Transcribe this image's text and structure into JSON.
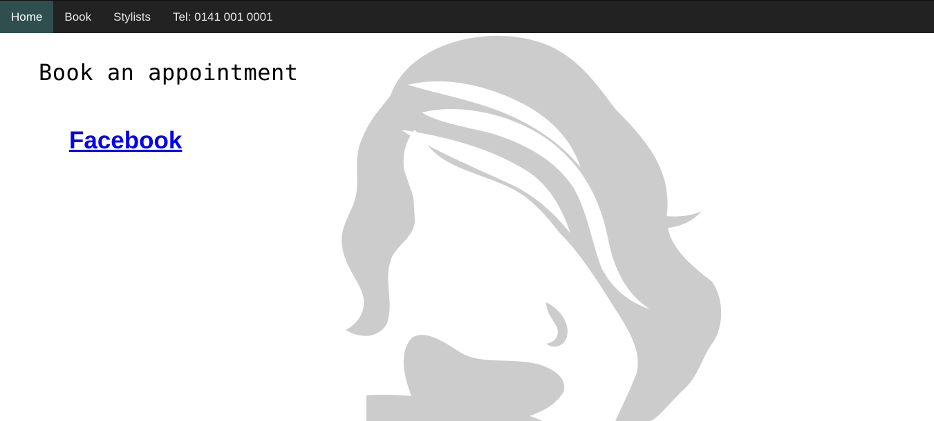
{
  "nav": {
    "items": [
      {
        "label": "Home",
        "active": true
      },
      {
        "label": "Book",
        "active": false
      },
      {
        "label": "Stylists",
        "active": false
      }
    ],
    "phone": "Tel: 0141 001 0001"
  },
  "main": {
    "title": "Book an appointment",
    "facebook_link": "Facebook"
  },
  "colors": {
    "navbar_bg": "#222222",
    "active_nav_bg": "#2f4f4f",
    "link": "#0000ee",
    "silhouette": "#cccccc"
  },
  "background_image": "woman-hair-silhouette"
}
